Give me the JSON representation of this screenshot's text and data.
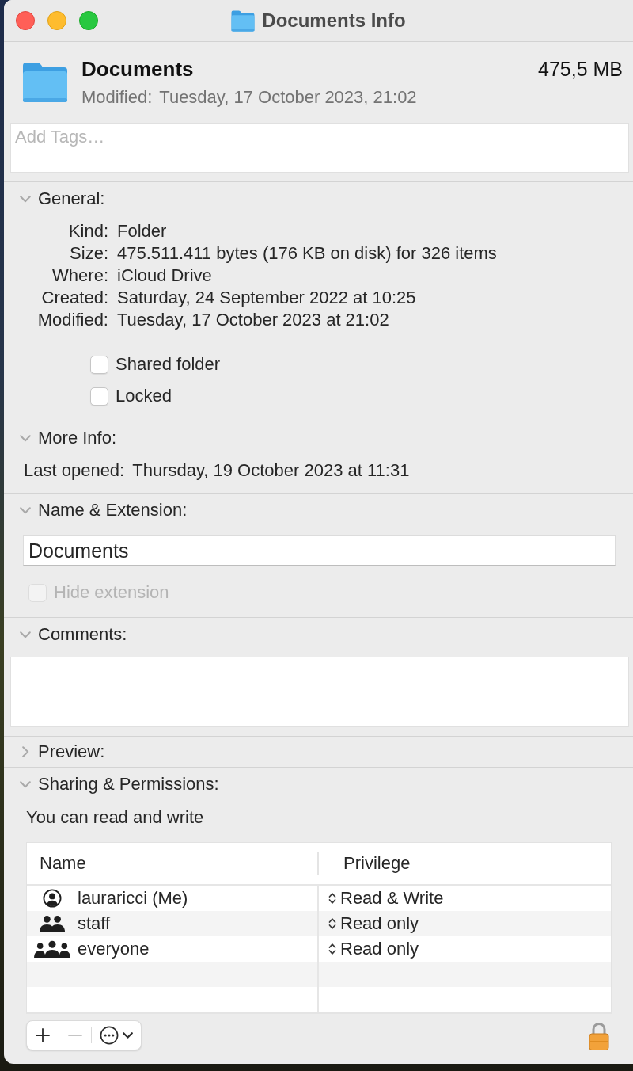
{
  "window": {
    "title": "Documents Info"
  },
  "header": {
    "name": "Documents",
    "size": "475,5 MB",
    "modified_label": "Modified:",
    "modified_value": "Tuesday, 17 October 2023, 21:02"
  },
  "tags": {
    "placeholder": "Add Tags…"
  },
  "sections": [
    {
      "kind": "general",
      "title": "General:",
      "expanded": true,
      "rows": [
        {
          "label": "Kind:",
          "value": "Folder"
        },
        {
          "label": "Size:",
          "value": "475.511.411 bytes (176 KB on disk) for 326 items"
        },
        {
          "label": "Where:",
          "value": "iCloud Drive"
        },
        {
          "label": "Created:",
          "value": "Saturday, 24 September 2022 at 10:25"
        },
        {
          "label": "Modified:",
          "value": "Tuesday, 17 October 2023 at 21:02"
        }
      ],
      "checkboxes": [
        {
          "label": "Shared folder",
          "checked": false,
          "disabled": false
        },
        {
          "label": "Locked",
          "checked": false,
          "disabled": false
        }
      ]
    },
    {
      "kind": "more_info",
      "title": "More Info:",
      "expanded": true,
      "rows": [
        {
          "label": "Last opened:",
          "value": "Thursday, 19 October 2023 at 11:31"
        }
      ]
    },
    {
      "kind": "name_extension",
      "title": "Name & Extension:",
      "expanded": true,
      "name_field": {
        "value": "Documents"
      },
      "checkboxes": [
        {
          "label": "Hide extension",
          "checked": false,
          "disabled": true
        }
      ]
    },
    {
      "kind": "comments",
      "title": "Comments:",
      "expanded": true
    },
    {
      "kind": "preview",
      "title": "Preview:",
      "expanded": false
    },
    {
      "kind": "sharing",
      "title": "Sharing & Permissions:",
      "expanded": true,
      "summary": "You can read and write",
      "table": {
        "columns": [
          "Name",
          "Privilege"
        ],
        "rows": [
          {
            "kind": "user",
            "name": "lauraricci (Me)",
            "privilege": "Read & Write"
          },
          {
            "kind": "group",
            "name": "staff",
            "privilege": "Read only"
          },
          {
            "kind": "everyone",
            "name": "everyone",
            "privilege": "Read only"
          }
        ]
      },
      "toolbar": [
        {
          "kind": "add",
          "disabled": false
        },
        {
          "kind": "remove",
          "disabled": true
        },
        {
          "kind": "action_menu",
          "disabled": false
        }
      ],
      "locked": true
    }
  ]
}
